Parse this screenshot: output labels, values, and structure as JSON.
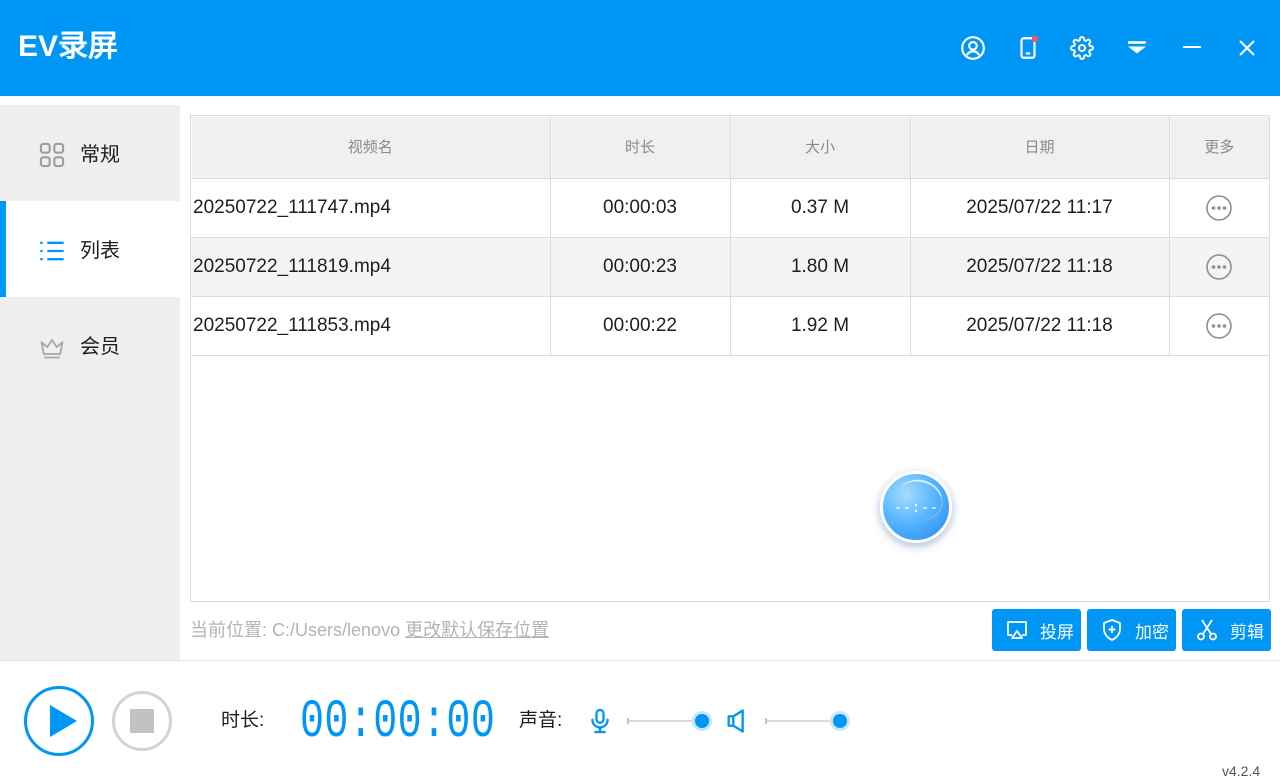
{
  "app": {
    "title": "EV录屏",
    "version": "v4.2.4"
  },
  "theme": {
    "accent": "#0096f5",
    "sidebar_bg": "#efefef",
    "notification_dot": "#f2566b"
  },
  "titlebar": {
    "icons": [
      "user-icon",
      "phone-icon",
      "gear-icon",
      "menu-dropdown-icon",
      "minimize-icon",
      "close-icon"
    ],
    "phone_has_notification": true
  },
  "sidebar": {
    "items": [
      {
        "label": "常规",
        "icon": "grid-icon",
        "active": false
      },
      {
        "label": "列表",
        "icon": "list-icon",
        "active": true
      },
      {
        "label": "会员",
        "icon": "crown-icon",
        "active": false
      }
    ]
  },
  "table": {
    "headers": [
      "视频名",
      "时长",
      "大小",
      "日期",
      "更多"
    ],
    "more_icon": "more-icon",
    "rows": [
      {
        "name": "20250722_111747.mp4",
        "duration": "00:00:03",
        "size": "0.37 M",
        "date": "2025/07/22 11:17"
      },
      {
        "name": "20250722_111819.mp4",
        "duration": "00:00:23",
        "size": "1.80 M",
        "date": "2025/07/22 11:18"
      },
      {
        "name": "20250722_111853.mp4",
        "duration": "00:00:22",
        "size": "1.92 M",
        "date": "2025/07/22 11:18"
      }
    ]
  },
  "float_timer": {
    "text": "--:--"
  },
  "save_location": {
    "label": "当前位置:",
    "path": "C:/Users/lenovo",
    "change_link": "更改默认保存位置"
  },
  "actions": [
    {
      "label": "投屏",
      "icon": "cast-icon"
    },
    {
      "label": "加密",
      "icon": "shield-plus-icon"
    },
    {
      "label": "剪辑",
      "icon": "scissors-icon"
    }
  ],
  "controls": {
    "play_icon": "play-icon",
    "stop_icon": "stop-icon",
    "duration_label": "时长:",
    "timer": "00:00:00",
    "sound_label": "声音:",
    "mic": {
      "icon": "mic-icon",
      "level": 1.0
    },
    "speaker": {
      "icon": "speaker-icon",
      "level": 1.0
    }
  }
}
